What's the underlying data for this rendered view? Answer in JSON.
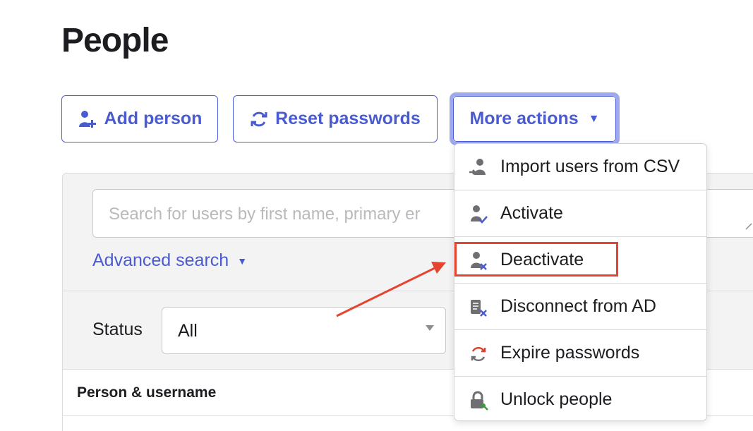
{
  "page": {
    "title": "People"
  },
  "toolbar": {
    "add_person": "Add person",
    "reset_passwords": "Reset passwords",
    "more_actions": "More actions"
  },
  "search": {
    "placeholder": "Search for users by first name, primary er",
    "advanced": "Advanced search"
  },
  "filter": {
    "status_label": "Status",
    "status_value": "All"
  },
  "table": {
    "headers": [
      "Person & username"
    ]
  },
  "menu": {
    "items": [
      {
        "label": "Import users from CSV",
        "icon": "import-user-icon"
      },
      {
        "label": "Activate",
        "icon": "activate-user-icon"
      },
      {
        "label": "Deactivate",
        "icon": "deactivate-user-icon"
      },
      {
        "label": "Disconnect from AD",
        "icon": "disconnect-ad-icon"
      },
      {
        "label": "Expire passwords",
        "icon": "expire-passwords-icon"
      },
      {
        "label": "Unlock people",
        "icon": "unlock-icon"
      }
    ]
  },
  "colors": {
    "accent": "#4a5bd1",
    "highlight": "#e5452e",
    "icon_gray": "#6e6e73",
    "expire_red": "#d9412b",
    "unlock_green": "#3a9b3f"
  }
}
